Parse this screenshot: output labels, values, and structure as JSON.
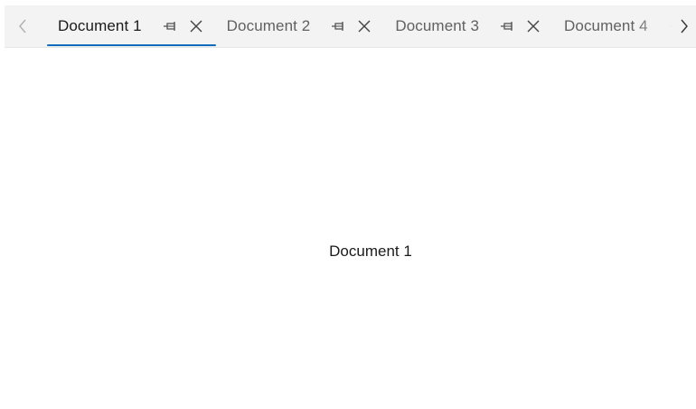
{
  "tabstrip": {
    "scroll_left_icon": "chevron-left-icon",
    "scroll_right_icon": "chevron-right-icon",
    "tabs": [
      {
        "label": "Document 1",
        "selected": true
      },
      {
        "label": "Document 2",
        "selected": false
      },
      {
        "label": "Document 3",
        "selected": false
      },
      {
        "label": "Document 4",
        "selected": false
      }
    ],
    "pin_icon": "pin-icon",
    "close_icon": "close-icon",
    "accent_color": "#0f6cbd"
  },
  "content": {
    "text": "Document 1"
  }
}
